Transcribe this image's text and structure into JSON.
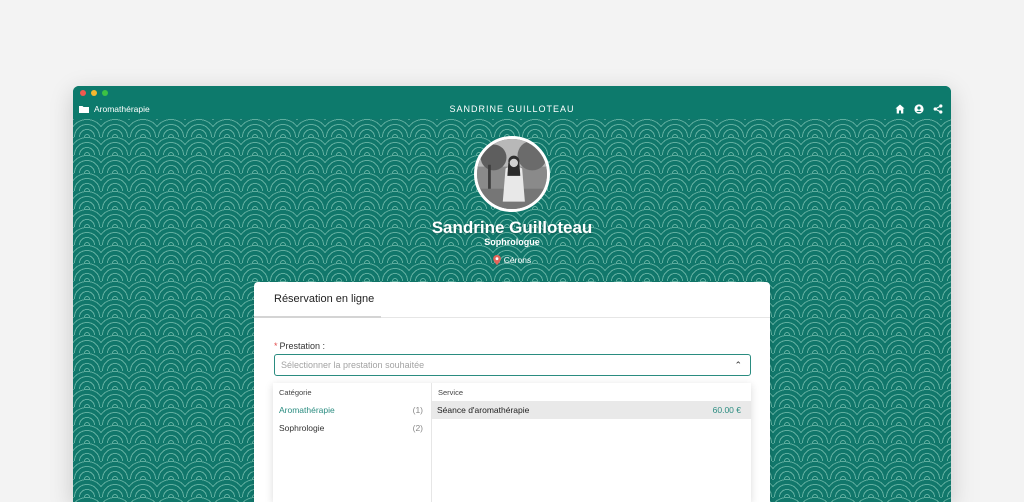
{
  "window": {
    "breadcrumb": "Aromathérapie",
    "title": "SANDRINE GUILLOTEAU"
  },
  "profile": {
    "name": "Sandrine Guilloteau",
    "role": "Sophrologue",
    "location": "Cérons"
  },
  "booking": {
    "tab_label": "Réservation en ligne",
    "field_label": "Prestation :",
    "required_mark": "*",
    "select_placeholder": "Sélectionner la prestation souhaitée",
    "category_header": "Catégorie",
    "service_header": "Service",
    "categories": [
      {
        "label": "Aromathérapie",
        "count": "(1)",
        "active": true
      },
      {
        "label": "Sophrologie",
        "count": "(2)",
        "active": false
      }
    ],
    "services": [
      {
        "label": "Séance d'aromathérapie",
        "price": "60.00 €"
      }
    ]
  },
  "colors": {
    "brand_teal": "#0d7a6c",
    "accent": "#2a8c80",
    "required": "#e14b4b"
  },
  "icons": [
    "folder-icon",
    "home-icon",
    "user-icon",
    "share-icon",
    "location-pin-icon",
    "chevron-up-icon"
  ]
}
